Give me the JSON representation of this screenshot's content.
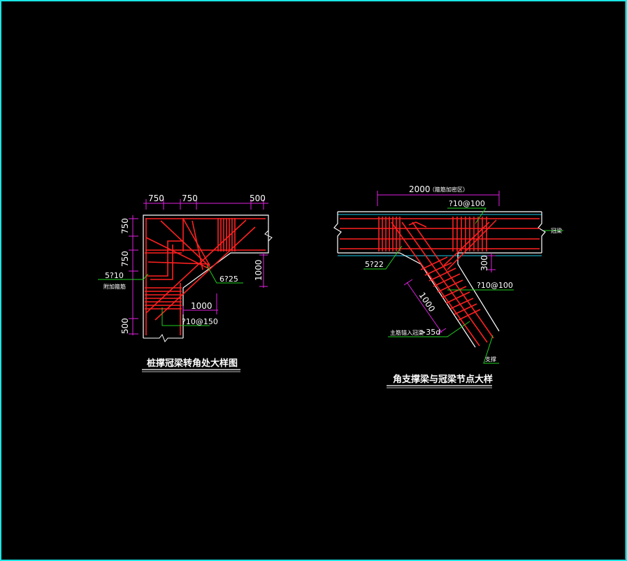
{
  "colors": {
    "background": "#000000",
    "frame": "#19e6e6",
    "rebar": "#ff2020",
    "concrete": "#ffffff",
    "dimension": "#e020e0",
    "leader": "#20d020",
    "cover": "#19c8e6",
    "text": "#ffffff"
  },
  "left_detail": {
    "title": "桩撑冠梁转角处大样图",
    "dims": {
      "top_a": "750",
      "top_b": "750",
      "top_c": "500",
      "left_a": "750",
      "left_b": "750",
      "left_c": "500",
      "right": "1000",
      "bottom": "1000"
    },
    "callouts": {
      "main_bar": "5?10",
      "main_bar_note": "附加箍筋",
      "diag_bar": "6?25",
      "stirrup": "?10@150"
    }
  },
  "right_detail": {
    "title": "角支撑梁与冠梁节点大样",
    "dims": {
      "top": "2000",
      "top_note": "（箍筋加密区）",
      "side": "300",
      "diag": "1000"
    },
    "callouts": {
      "top_stirrup": "?10@100",
      "main_bar": "5?22",
      "right_stirrup": "?10@100",
      "anchor": "主筋锚入冠梁≥35d",
      "anchor_label": "主筋锚入冠梁",
      "anchor_value": ">35d",
      "beam_label": "冠梁",
      "brace_label": "支撑"
    }
  }
}
